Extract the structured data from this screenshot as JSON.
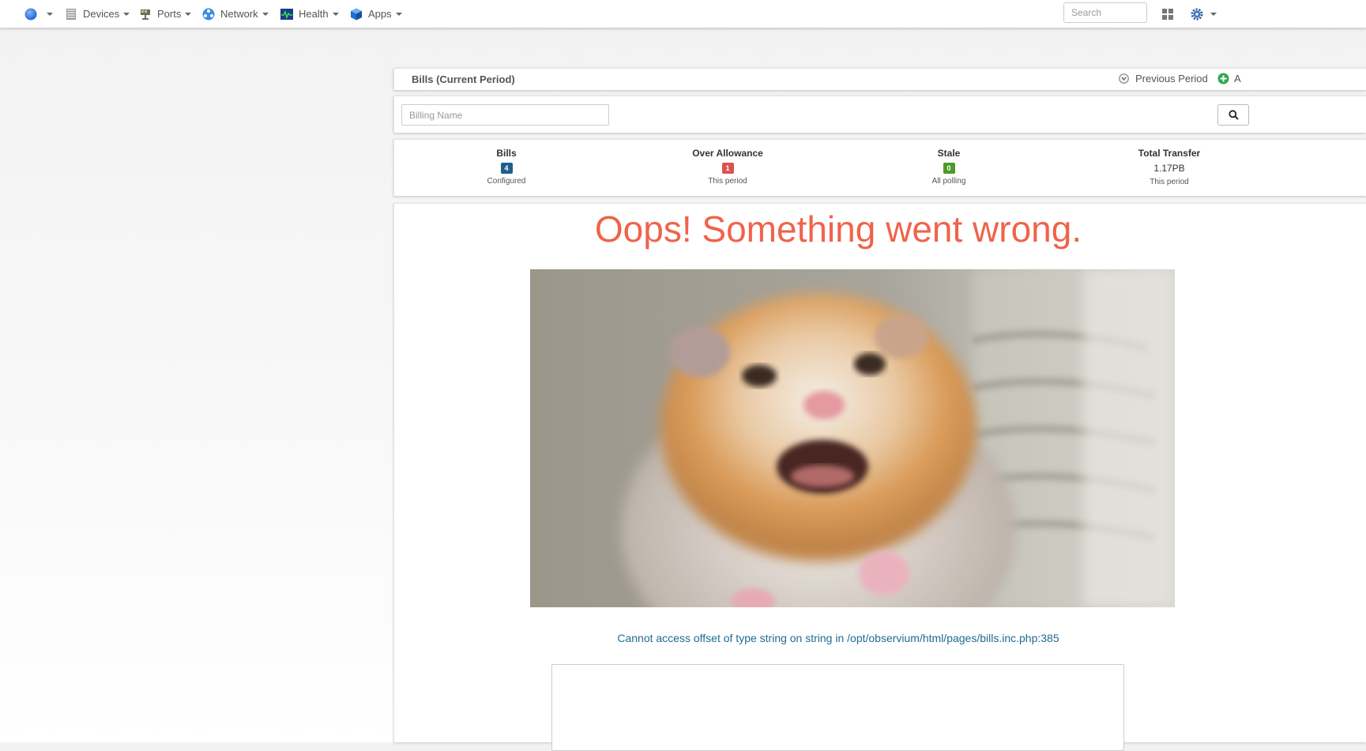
{
  "navbar": {
    "menus": [
      {
        "label": "Devices",
        "icon": "devices-icon"
      },
      {
        "label": "Ports",
        "icon": "ports-icon"
      },
      {
        "label": "Network",
        "icon": "network-icon"
      },
      {
        "label": "Health",
        "icon": "health-icon"
      },
      {
        "label": "Apps",
        "icon": "apps-icon"
      }
    ],
    "search_placeholder": "Search"
  },
  "bills_header": {
    "title": "Bills (Current Period)",
    "previous_period_label": "Previous Period",
    "add_label": "A"
  },
  "filter": {
    "billing_name_placeholder": "Billing Name"
  },
  "stats": [
    {
      "label": "Bills",
      "badge": "4",
      "badge_color": "#1f5f8a",
      "sub": "Configured"
    },
    {
      "label": "Over Allowance",
      "badge": "1",
      "badge_color": "#d9534f",
      "sub": "This period"
    },
    {
      "label": "Stale",
      "badge": "0",
      "badge_color": "#4c9a2a",
      "sub": "All polling"
    },
    {
      "label": "Total Transfer",
      "value": "1.17PB",
      "sub": "This period"
    }
  ],
  "error": {
    "heading": "Oops! Something went wrong.",
    "message": "Cannot access offset of type string on string in /opt/observium/html/pages/bills.inc.php:385"
  },
  "colors": {
    "error_heading": "#f0634b",
    "error_message": "#1e6b92"
  }
}
